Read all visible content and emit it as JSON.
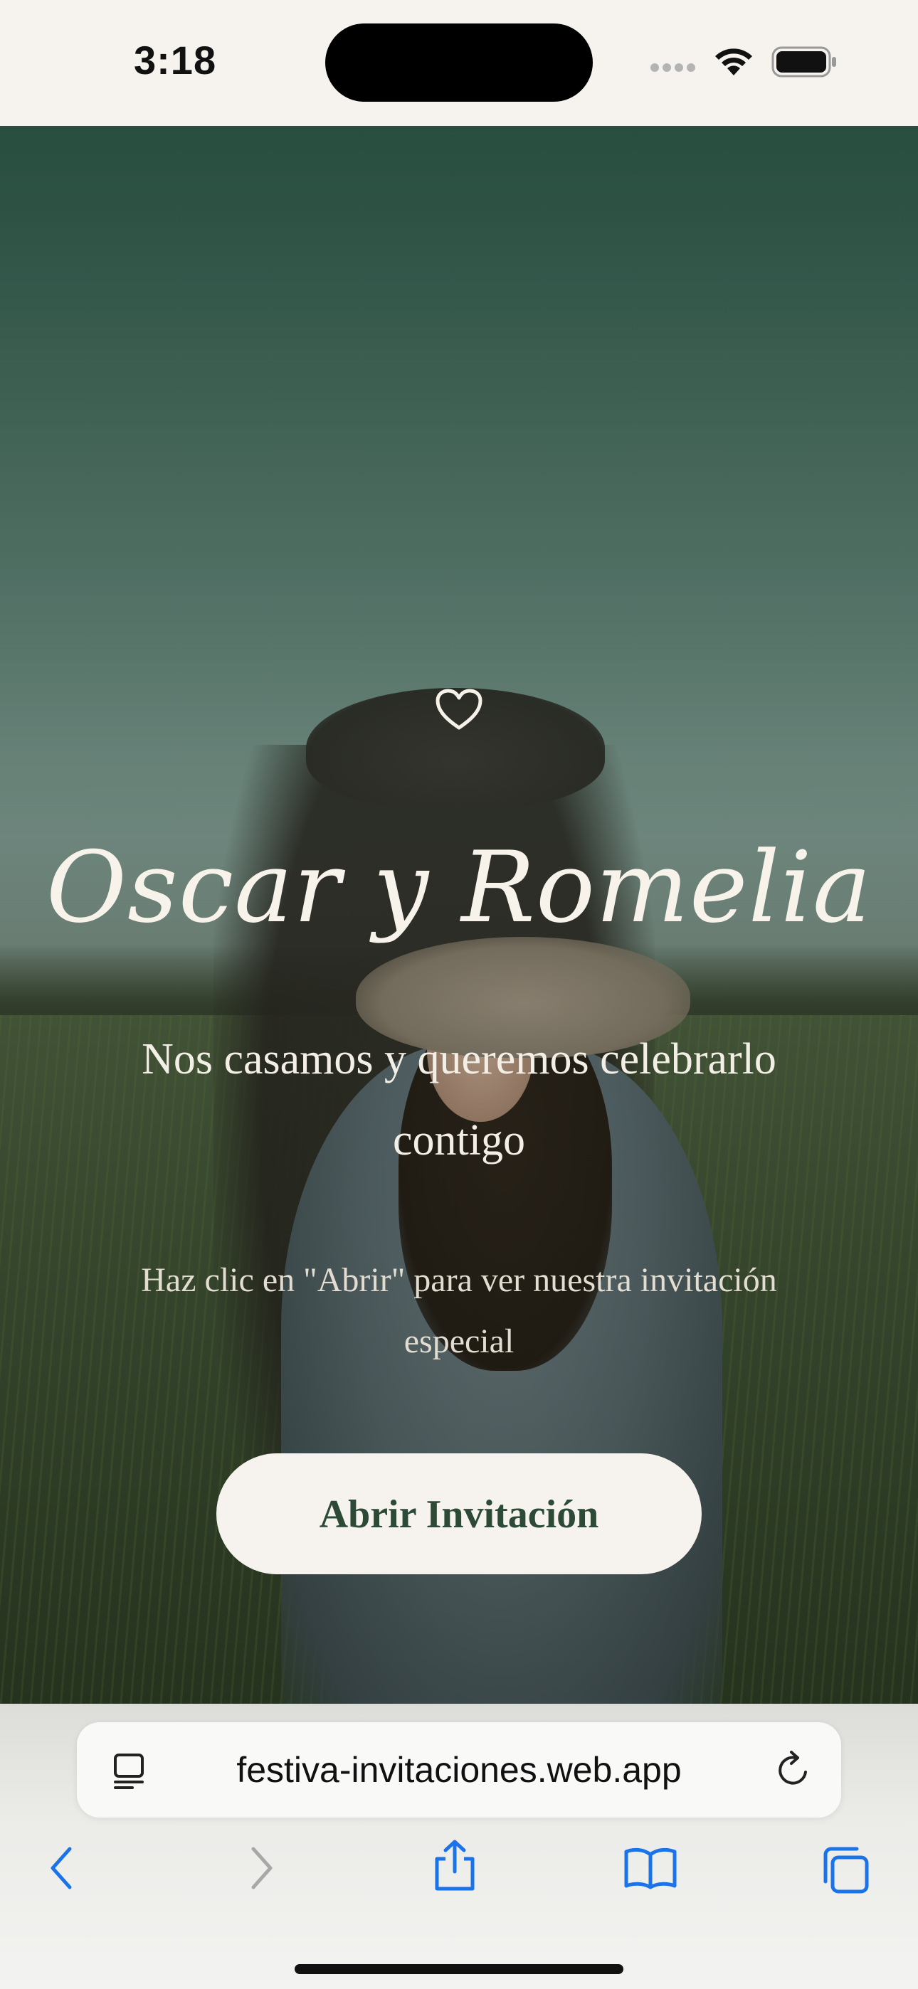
{
  "status_bar": {
    "time": "3:18"
  },
  "invitation": {
    "names": "Oscar y Romelia",
    "tagline": "Nos casamos y queremos celebrarlo contigo",
    "instructions": "Haz clic en \"Abrir\" para ver nuestra invitación especial",
    "open_button_label": "Abrir Invitación",
    "accent_color": "#2c4a36",
    "icon": "heart-icon"
  },
  "browser": {
    "url": "festiva-invitaciones.web.app",
    "icons": [
      "reader-icon",
      "reload-icon",
      "back-icon",
      "forward-icon",
      "share-icon",
      "bookmarks-icon",
      "tabs-icon"
    ]
  }
}
